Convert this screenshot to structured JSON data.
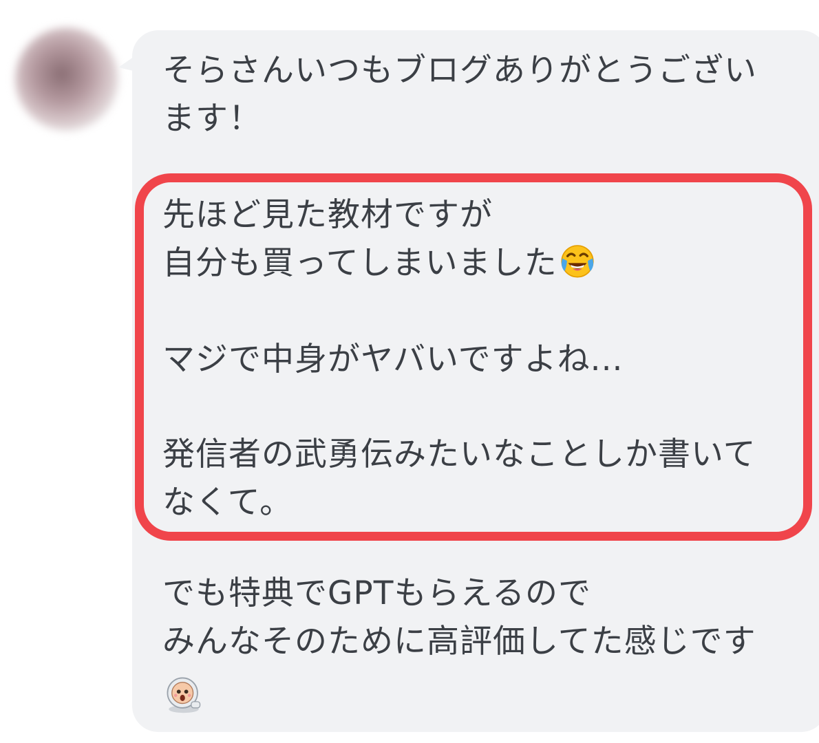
{
  "message": {
    "greeting_line1": "そらさんいつもブログありがとうござい",
    "greeting_line2": "ます！",
    "highlight_line1": "先ほど見た教材ですが",
    "highlight_line2": "自分も買ってしまいました",
    "highlight_line3": "マジで中身がヤバいですよね...",
    "highlight_line4": "発信者の武勇伝みたいなことしか書いて",
    "highlight_line5": "なくて。",
    "closing_line1": "でも特典でGPTもらえるので",
    "closing_line2": "みんなそのために高評価してた感じです"
  },
  "icons": {
    "avatar": "blurred-user-avatar",
    "emoji_after_line2": "laughing-crying-emoji",
    "sticker_end": "baby-astronaut-sticker"
  },
  "colors": {
    "bubble_bg": "#f1f2f4",
    "text": "#3b3f45",
    "highlight_border": "#f0454b"
  }
}
